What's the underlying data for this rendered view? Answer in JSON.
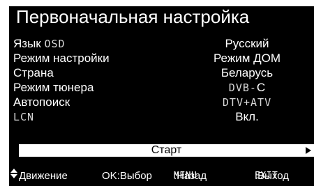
{
  "title": "Первоначальная настройка",
  "settings": [
    {
      "label": "Язык",
      "label_suffix": "OSD",
      "value": "Русский"
    },
    {
      "label": "Режим настройки",
      "label_suffix": "",
      "value": "Режим ДОМ"
    },
    {
      "label": "Страна",
      "label_suffix": "",
      "value": "Беларусь"
    },
    {
      "label": "Режим тюнера",
      "label_suffix": "",
      "value_mono": "DVB-",
      "value": "C"
    },
    {
      "label": "Автопоиск",
      "label_suffix": "",
      "value_mono": "DTV+ATV"
    },
    {
      "label_mono": "LCN",
      "value": "Вкл."
    }
  ],
  "start_label": "Старт",
  "footer": {
    "move": "Движение",
    "ok": "OK:Выбор",
    "menu_key": "MENU",
    "menu_label": ":Назад",
    "exit_key": "EXIT",
    "exit_label": ":Выход"
  },
  "colors": {
    "background": "#000000",
    "text": "#ffffff",
    "highlight_bar": "#ffffff",
    "highlight_text": "#000000"
  },
  "icons": {
    "updown": "up-down-arrows-icon",
    "right": "right-arrow-icon"
  }
}
